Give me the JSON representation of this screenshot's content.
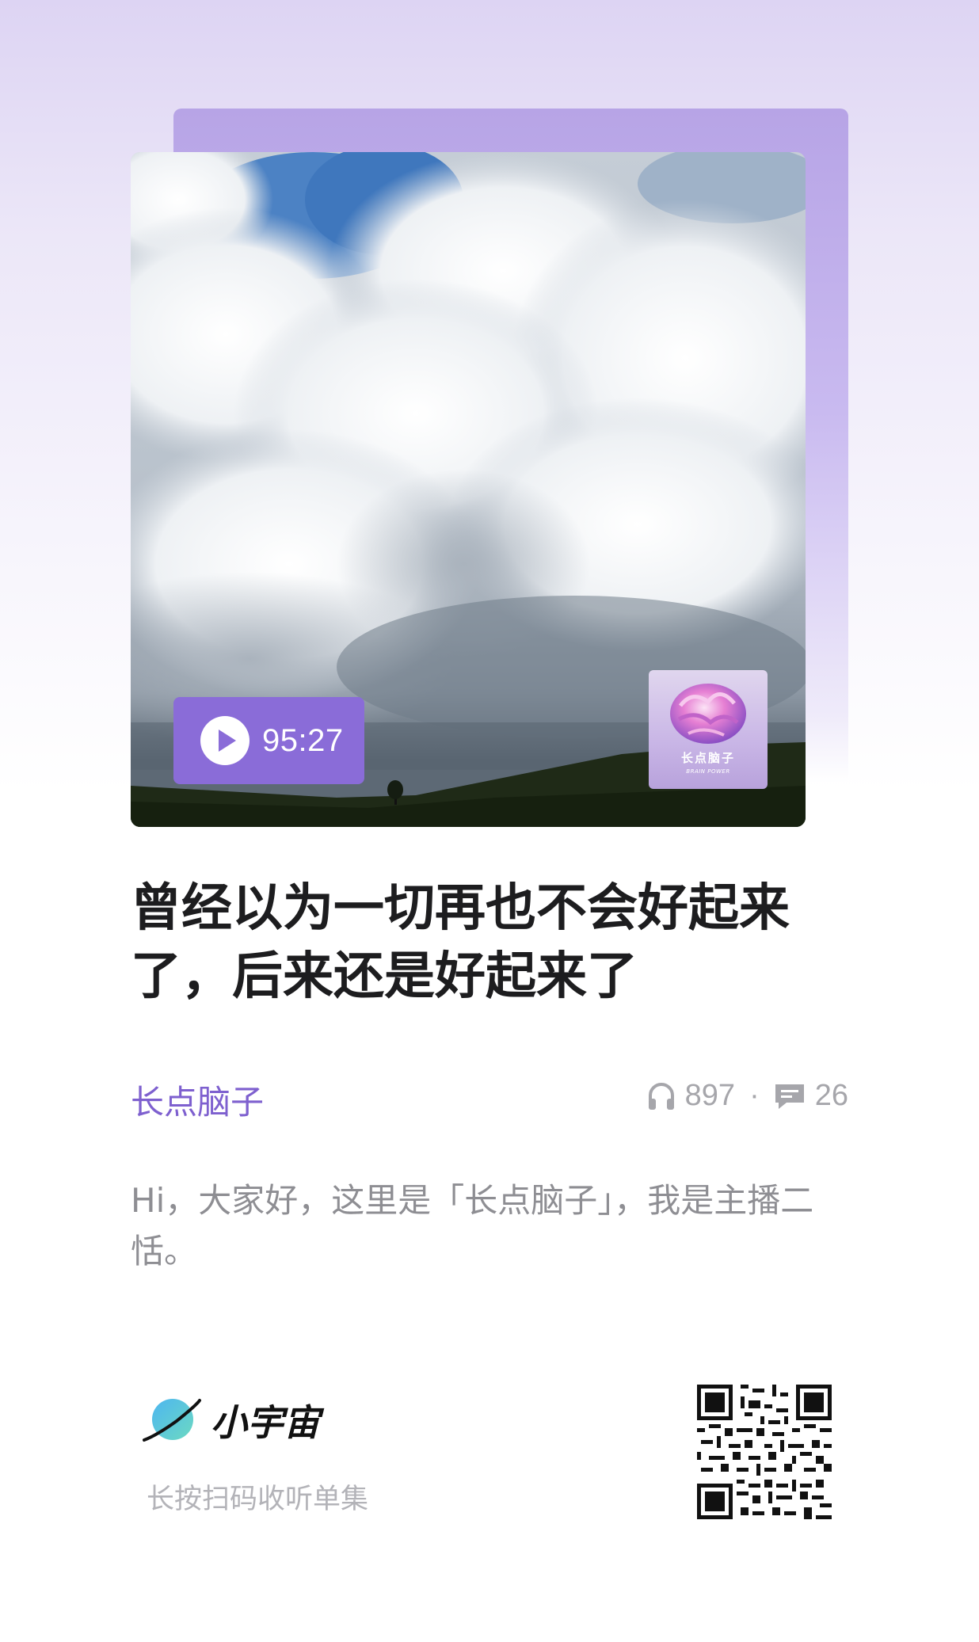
{
  "episode": {
    "duration": "95:27",
    "title": "曾经以为一切再也不会好起来了，后来还是好起来了",
    "description": "Hi，大家好，这里是「长点脑子」，我是主播二恬。"
  },
  "podcast": {
    "name": "长点脑子",
    "cover_name": "长点脑子",
    "cover_subtitle": "BRAIN POWER"
  },
  "stats": {
    "plays": "897",
    "separator": "·",
    "comments": "26"
  },
  "brand": {
    "name": "小宇宙",
    "scan_hint": "长按扫码收听单集"
  },
  "colors": {
    "accent": "#8a6cd8",
    "author": "#7e60cf"
  },
  "icons": {
    "play": "play-icon",
    "listens": "headphones-icon",
    "comments": "comment-icon",
    "logo": "planet-logo-icon"
  }
}
